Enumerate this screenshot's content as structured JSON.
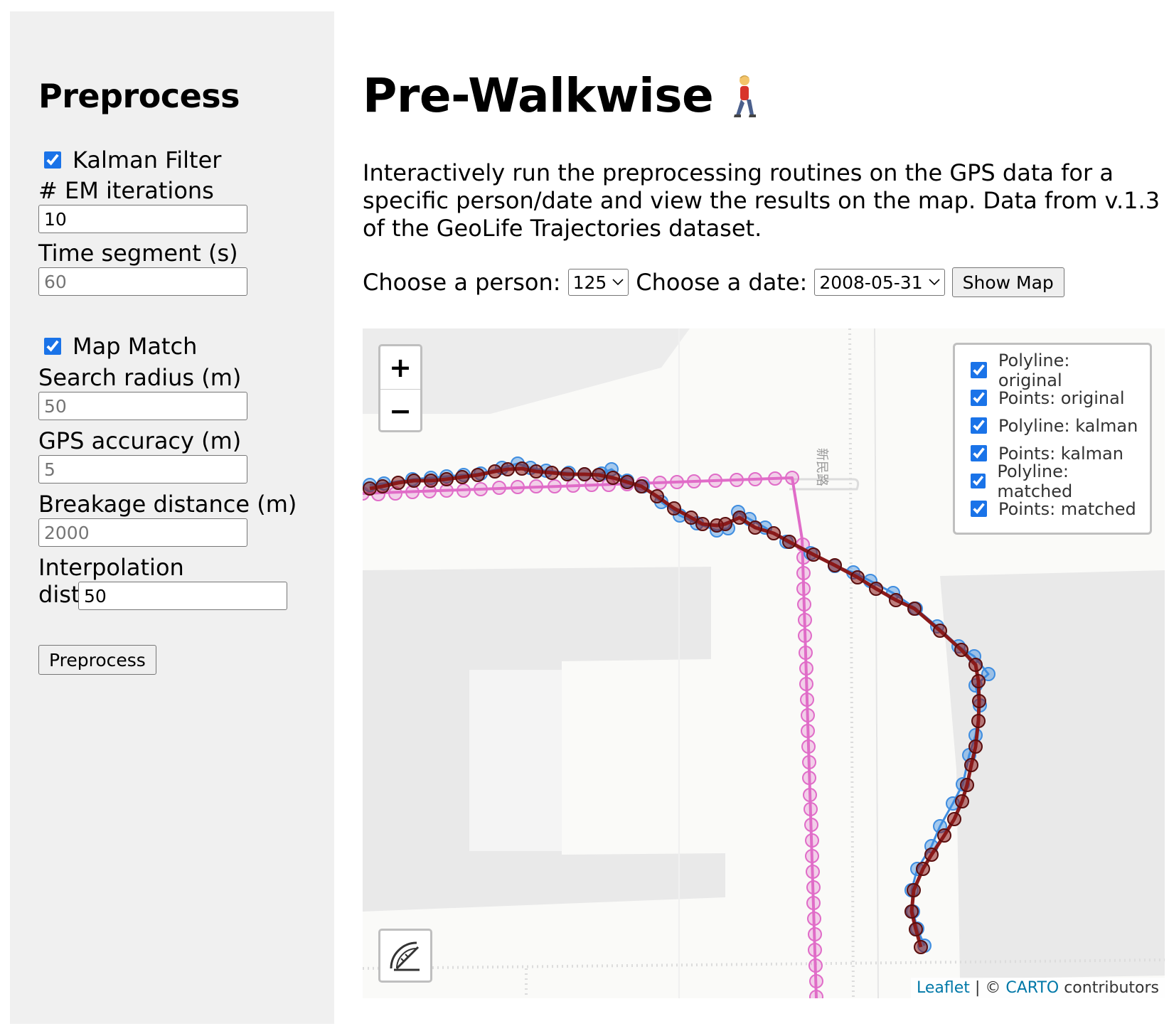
{
  "sidebar": {
    "title": "Preprocess",
    "kalman": {
      "checkbox_label": "Kalman Filter",
      "checked": true,
      "em_iterations_label": "# EM iterations",
      "em_iterations_value": "10",
      "time_segment_label": "Time segment (s)",
      "time_segment_placeholder": "60"
    },
    "map_match": {
      "checkbox_label": "Map Match",
      "checked": true,
      "search_radius_label": "Search radius (m)",
      "search_radius_placeholder": "50",
      "gps_accuracy_label": "GPS accuracy (m)",
      "gps_accuracy_placeholder": "5",
      "breakage_distance_label": "Breakage distance (m)",
      "breakage_distance_placeholder": "2000",
      "interpolation_label": "Interpolation distance (m)",
      "interpolation_value": "50"
    },
    "preprocess_button": "Preprocess"
  },
  "main": {
    "title": "Pre-Walkwise",
    "description": "Interactively run the preprocessing routines on the GPS data for a specific person/date and view the results on the map. Data from v.1.3 of the GeoLife Trajectories dataset.",
    "person_label": "Choose a person:",
    "person_value": "125",
    "date_label": "Choose a date:",
    "date_value": "2008-05-31",
    "show_map_button": "Show Map"
  },
  "map": {
    "zoom_in": "+",
    "zoom_out": "−",
    "street_label": "新民路",
    "layers": [
      {
        "label": "Polyline: original",
        "checked": true
      },
      {
        "label": "Points: original",
        "checked": true
      },
      {
        "label": "Polyline: kalman",
        "checked": true
      },
      {
        "label": "Points: kalman",
        "checked": true
      },
      {
        "label": "Polyline: matched",
        "checked": true
      },
      {
        "label": "Points: matched",
        "checked": true
      }
    ],
    "attribution": {
      "leaflet": "Leaflet",
      "separator": "| ©",
      "carto": "CARTO",
      "contributors": "contributors"
    },
    "colors": {
      "original": "#3f8de0",
      "kalman": "#8b1a1a",
      "matched": "#e06cc8"
    }
  }
}
